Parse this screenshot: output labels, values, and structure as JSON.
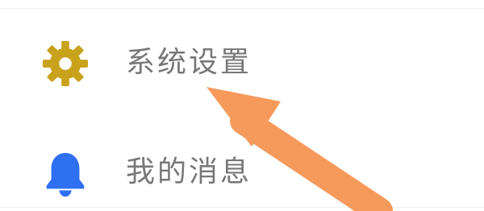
{
  "menu": {
    "items": [
      {
        "label": "系统设置",
        "icon": "gear-icon",
        "icon_color": "#C9A21C"
      },
      {
        "label": "我的消息",
        "icon": "bell-icon",
        "icon_color": "#2F6FF2"
      }
    ]
  },
  "style": {
    "label_color": "#777777",
    "annotation_arrow_color": "#F59A5A"
  }
}
